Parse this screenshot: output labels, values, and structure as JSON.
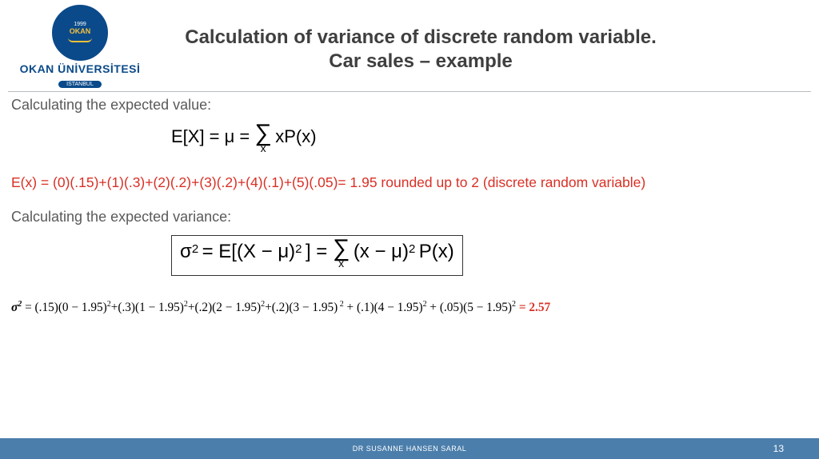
{
  "logo": {
    "inner_year": "1999",
    "inner_text": "OKAN",
    "line1": "OKAN ÜNİVERSİTESİ",
    "line2": "İSTANBUL"
  },
  "title": {
    "line1": "Calculation of variance of discrete random variable.",
    "line2": "Car sales – example"
  },
  "body": {
    "expected_value_label": "Calculating the expected value:",
    "formula1_lhs": "E[X] = μ = ",
    "formula1_rhs": "xP(x)",
    "formula1_sub": "x",
    "expected_value_calc": "E(x) = (0)(.15)+(1)(.3)+(2)(.2)+(3)(.2)+(4)(.1)+(5)(.05)= 1.95  rounded up to 2 (discrete random variable)",
    "variance_label": "Calculating the expected variance:",
    "formula2_lhs": "σ",
    "formula2_mid": " = E[(X − μ)",
    "formula2_mid2": "] = ",
    "formula2_rhs": "(x − μ)",
    "formula2_rhs2": "P(x)",
    "formula2_sub": "x",
    "sigma2_prefix": "σ",
    "sigma2_eq": " = (.15)(0 − 1.95)",
    "t1": "+(.3)(1 − 1.95)",
    "t2": "+(.2)(2 − 1.95)",
    "t3": "+(.2)(3 − 1.95)",
    "t4": " + (.1)(4 − 1.95)",
    "t5": " + (.05)(5 − 1.95)",
    "answer_eq": " = ",
    "answer": "2.57"
  },
  "footer": {
    "author": "DR SUSANNE HANSEN SARAL",
    "page": "13"
  }
}
